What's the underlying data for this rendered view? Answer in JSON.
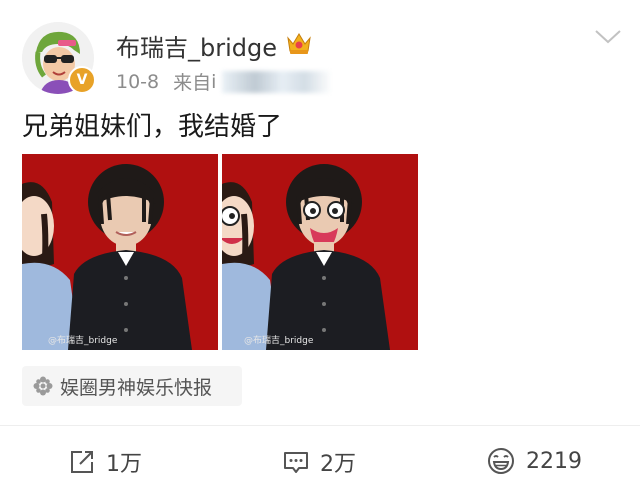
{
  "post": {
    "author": "布瑞吉_bridge",
    "date": "10-8",
    "source_prefix": "来自",
    "source_partial": "i",
    "text": "兄弟姐妹们，我结婚了",
    "verified_badge": "V",
    "crown_icon": "crown-icon",
    "photos": [
      {
        "watermark": "@布瑞吉_bridge",
        "background": "#b01010"
      },
      {
        "watermark": "@布瑞吉_bridge",
        "background": "#b01010"
      }
    ],
    "topic_tag": "娱圈男神娱乐快报"
  },
  "actions": {
    "share_count": "1万",
    "comment_count": "2万",
    "like_count": "2219"
  },
  "colors": {
    "username": "#333333",
    "meta": "#8c8c8c",
    "verified": "#e8a227",
    "photo_bg": "#b01010"
  }
}
